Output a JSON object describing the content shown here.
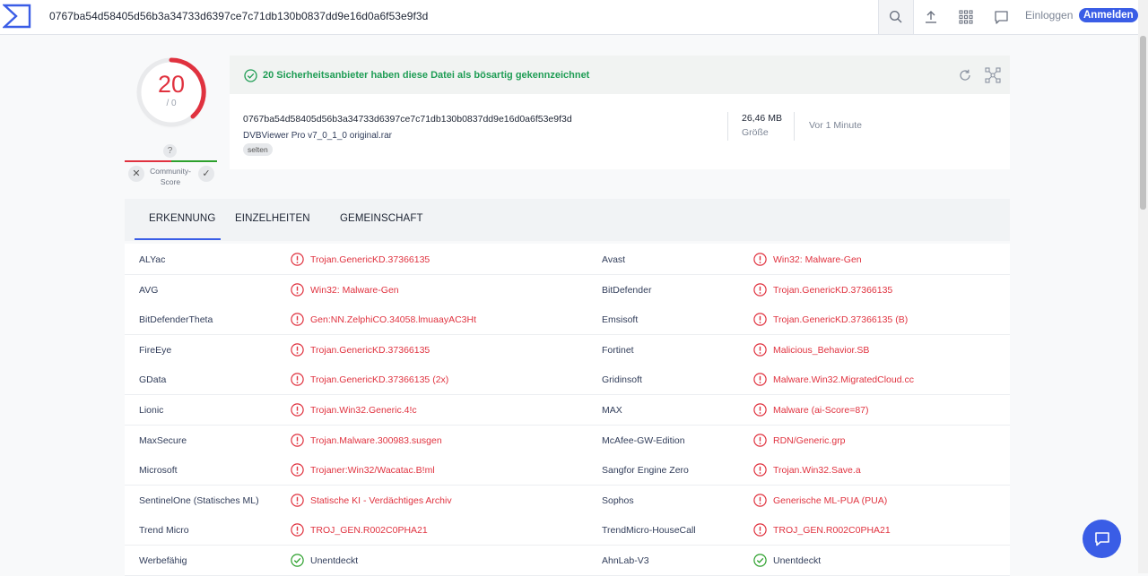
{
  "topbar": {
    "search_value": "0767ba54d58405d56b3a34733d6397ce7c71db130b0837dd9e16d0a6f53e9f3d",
    "login_label": "Einloggen",
    "signup_label": "Anmelden"
  },
  "score": {
    "detections": "20",
    "total": "/ 0",
    "question": "?",
    "community_label_line1": "Community-",
    "community_label_line2": "Score",
    "vote_down": "✕",
    "vote_up": "✓"
  },
  "summary": {
    "alert_text": "20 Sicherheitsanbieter haben diese Datei als bösartig gekennzeichnet",
    "hash": "0767ba54d58405d56b3a34733d6397ce7c71db130b0837dd9e16d0a6f53e9f3d",
    "filename": "DVBViewer Pro v7_0_1_0 original.rar",
    "tag": "selten",
    "size_value": "26,46 MB",
    "size_label": "Größe",
    "time": "Vor 1 Minute"
  },
  "tabs": [
    {
      "label": "ERKENNUNG"
    },
    {
      "label": "EINZELHEITEN"
    },
    {
      "label": "GEMEINSCHAFT"
    }
  ],
  "detections": [
    {
      "left": {
        "engine": "ALYac",
        "result": "Trojan.GenericKD.37366135",
        "status": "malicious"
      },
      "right": {
        "engine": "Avast",
        "result": "Win32: Malware-Gen",
        "status": "malicious"
      }
    },
    {
      "left": {
        "engine": "AVG",
        "result": "Win32: Malware-Gen",
        "status": "malicious"
      },
      "right": {
        "engine": "BitDefender",
        "result": "Trojan.GenericKD.37366135",
        "status": "malicious"
      }
    },
    {
      "left": {
        "engine": "BitDefenderTheta",
        "result": "Gen:NN.ZelphiCO.34058.lmuaayAC3Ht",
        "status": "malicious"
      },
      "right": {
        "engine": "Emsisoft",
        "result": "Trojan.GenericKD.37366135 (B)",
        "status": "malicious"
      }
    },
    {
      "left": {
        "engine": "FireEye",
        "result": "Trojan.GenericKD.37366135",
        "status": "malicious"
      },
      "right": {
        "engine": "Fortinet",
        "result": "Malicious_Behavior.SB",
        "status": "malicious"
      }
    },
    {
      "left": {
        "engine": "GData",
        "result": "Trojan.GenericKD.37366135 (2x)",
        "status": "malicious"
      },
      "right": {
        "engine": "Gridinsoft",
        "result": "Malware.Win32.MigratedCloud.cc",
        "status": "malicious"
      }
    },
    {
      "left": {
        "engine": "Lionic",
        "result": "Trojan.Win32.Generic.4!c",
        "status": "malicious"
      },
      "right": {
        "engine": "MAX",
        "result": "Malware (ai-Score=87)",
        "status": "malicious"
      }
    },
    {
      "left": {
        "engine": "MaxSecure",
        "result": "Trojan.Malware.300983.susgen",
        "status": "malicious"
      },
      "right": {
        "engine": "McAfee-GW-Edition",
        "result": "RDN/Generic.grp",
        "status": "malicious"
      }
    },
    {
      "left": {
        "engine": "Microsoft",
        "result": "Trojaner:Win32/Wacatac.B!ml",
        "status": "malicious"
      },
      "right": {
        "engine": "Sangfor Engine Zero",
        "result": "Trojan.Win32.Save.a",
        "status": "malicious"
      }
    },
    {
      "left": {
        "engine": "SentinelOne (Statisches ML)",
        "result": "Statische KI - Verdächtiges Archiv",
        "status": "malicious"
      },
      "right": {
        "engine": "Sophos",
        "result": "Generische ML-PUA (PUA)",
        "status": "malicious"
      }
    },
    {
      "left": {
        "engine": "Trend Micro",
        "result": "TROJ_GEN.R002C0PHA21",
        "status": "malicious"
      },
      "right": {
        "engine": "TrendMicro-HouseCall",
        "result": "TROJ_GEN.R002C0PHA21",
        "status": "malicious"
      }
    },
    {
      "left": {
        "engine": "Werbefähig",
        "result": "Unentdeckt",
        "status": "undetected"
      },
      "right": {
        "engine": "AhnLab-V3",
        "result": "Unentdeckt",
        "status": "undetected"
      }
    }
  ],
  "colors": {
    "malicious": "#e0323f",
    "clean": "#2ca02c",
    "accent": "#3a5de6"
  },
  "icons": {
    "logo": "virustotal-sigma-logo",
    "search": "search-icon",
    "upload": "upload-icon",
    "apps": "apps-grid-icon",
    "chat": "chat-icon",
    "alert": "check-circle-icon",
    "refresh": "refresh-icon",
    "graph": "graph-icon",
    "malicious": "alert-circle-icon",
    "undetected": "check-circle-icon"
  }
}
